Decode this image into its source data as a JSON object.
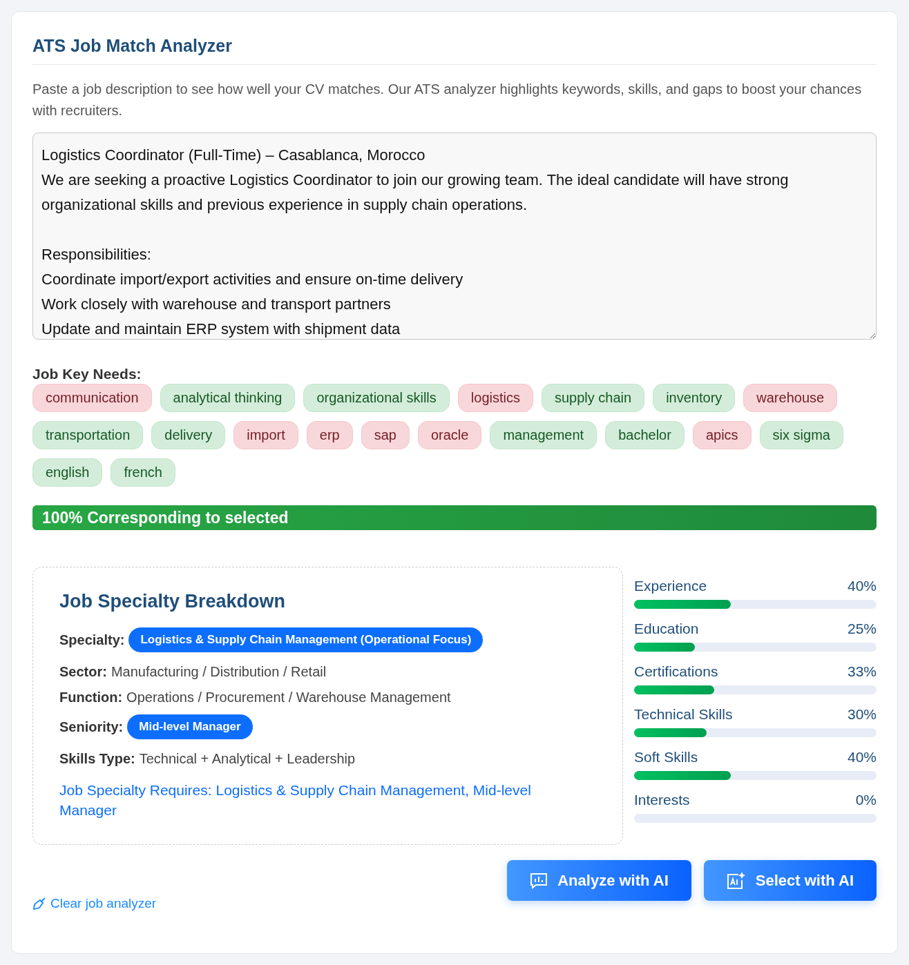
{
  "title": "ATS Job Match Analyzer",
  "intro": "Paste a job description to see how well your CV matches. Our ATS analyzer highlights keywords, skills, and gaps to boost your chances with recruiters.",
  "job_description": {
    "value": "Logistics Coordinator (Full-Time) – Casablanca, Morocco\nWe are seeking a proactive Logistics Coordinator to join our growing team. The ideal candidate will have strong organizational skills and previous experience in supply chain operations.\n\nResponsibilities:\nCoordinate import/export activities and ensure on-time delivery\nWork closely with warehouse and transport partners\nUpdate and maintain ERP system with shipment data"
  },
  "key_needs": {
    "label": "Job Key Needs:",
    "tags": [
      {
        "label": "communication",
        "matched": false
      },
      {
        "label": "analytical thinking",
        "matched": true
      },
      {
        "label": "organizational skills",
        "matched": true
      },
      {
        "label": "logistics",
        "matched": false
      },
      {
        "label": "supply chain",
        "matched": true
      },
      {
        "label": "inventory",
        "matched": true
      },
      {
        "label": "warehouse",
        "matched": false
      },
      {
        "label": "transportation",
        "matched": true
      },
      {
        "label": "delivery",
        "matched": true
      },
      {
        "label": "import",
        "matched": false
      },
      {
        "label": "erp",
        "matched": false
      },
      {
        "label": "sap",
        "matched": false
      },
      {
        "label": "oracle",
        "matched": false
      },
      {
        "label": "management",
        "matched": true
      },
      {
        "label": "bachelor",
        "matched": true
      },
      {
        "label": "apics",
        "matched": false
      },
      {
        "label": "six sigma",
        "matched": true
      },
      {
        "label": "english",
        "matched": true
      },
      {
        "label": "french",
        "matched": true
      }
    ]
  },
  "match_bar": {
    "label": "100% Corresponding to selected",
    "level": 1
  },
  "breakdown": {
    "title": "Job Specialty Breakdown",
    "fields": [
      {
        "label": "Specialty:",
        "value": "Logistics & Supply Chain Management (Operational Focus)",
        "kind": "pill"
      },
      {
        "label": "Sector:",
        "value": "Manufacturing / Distribution / Retail",
        "kind": "text"
      },
      {
        "label": "Function:",
        "value": "Operations / Procurement / Warehouse Management",
        "kind": "text"
      },
      {
        "label": "Seniority:",
        "value": "Mid-level Manager",
        "kind": "pill"
      },
      {
        "label": "Skills Type:",
        "value": "Technical + Analytical + Leadership",
        "kind": "text"
      }
    ],
    "requires": "Job Specialty Requires: Logistics & Supply Chain Management, Mid-level Manager"
  },
  "scores": [
    {
      "label": "Experience",
      "reading": "40%",
      "level": 0.4
    },
    {
      "label": "Education",
      "reading": "25%",
      "level": 0.25
    },
    {
      "label": "Certifications",
      "reading": "33%",
      "level": 0.33
    },
    {
      "label": "Technical Skills",
      "reading": "30%",
      "level": 0.3
    },
    {
      "label": "Soft Skills",
      "reading": "40%",
      "level": 0.4
    },
    {
      "label": "Interests",
      "reading": "0%"
    }
  ],
  "buttons": [
    {
      "label": "Analyze with AI",
      "kind": "analyze"
    },
    {
      "label": "Select with AI",
      "kind": "select"
    }
  ],
  "clear_link": "Clear job analyzer"
}
